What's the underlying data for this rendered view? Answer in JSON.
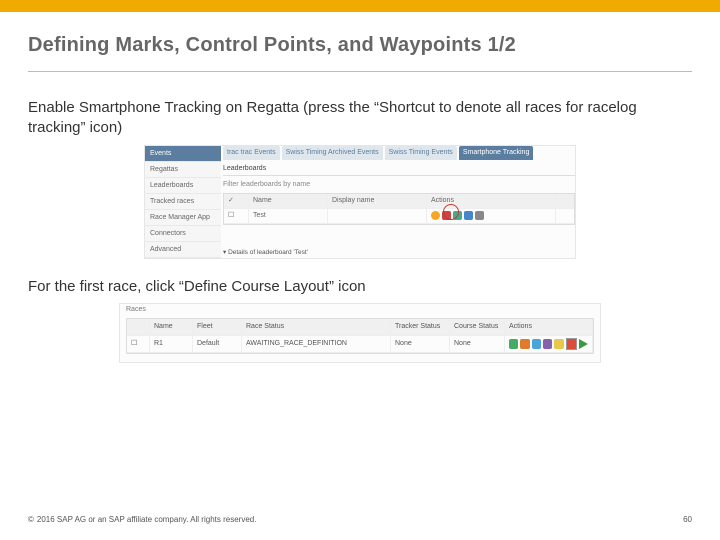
{
  "title": "Defining Marks, Control Points, and Waypoints 1/2",
  "body": {
    "step1": "Enable Smartphone Tracking on Regatta (press the “Shortcut to denote all races for racelog tracking” icon)",
    "step2": "For the first race, click “Define Course Layout” icon"
  },
  "shot1": {
    "sidebar": [
      "Events",
      "Regattas",
      "Leaderboards",
      "Tracked races",
      "Race Manager App",
      "Connectors",
      "Advanced"
    ],
    "tabs": [
      "trac trac Events",
      "Swiss Timing Archived Events",
      "Swiss Timing Events",
      "Smartphone Tracking"
    ],
    "section": "Leaderboards",
    "filter": "Filter leaderboards by name",
    "cols": [
      "✓",
      "Name",
      "Display name",
      "Actions"
    ],
    "row": {
      "name": "Test",
      "display": ""
    },
    "details": "▾ Details of leaderboard 'Test'"
  },
  "shot2": {
    "heading": "Races",
    "cols": [
      "Name",
      "Fleet",
      "Race Status",
      "Tracker Status",
      "Course Status",
      "Actions"
    ],
    "row": {
      "name": "R1",
      "fleet": "Default",
      "race_status": "AWAITING_RACE_DEFINITION",
      "tracker_status": "None",
      "course_status": "None"
    }
  },
  "footer": {
    "copyright": "2016 SAP AG or an SAP affiliate company. All rights reserved.",
    "page": "60"
  }
}
